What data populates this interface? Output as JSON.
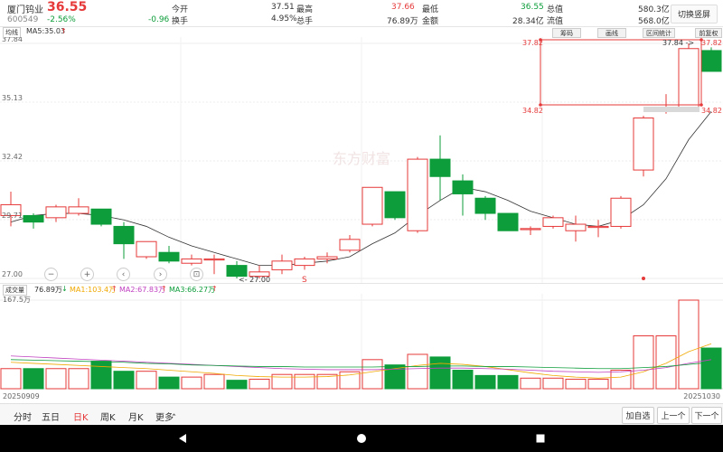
{
  "stock": {
    "name": "厦门钨业",
    "code": "600549",
    "price": "36.55",
    "change": "-0.96",
    "change_pct": "-2.56%"
  },
  "quote": {
    "open_label": "今开",
    "open": "37.51",
    "high_label": "最高",
    "high": "37.66",
    "low_label": "最低",
    "low": "36.55",
    "total_value_label": "总值",
    "total_value": "580.3亿",
    "turnover_label": "换手",
    "turnover": "4.95%",
    "volume_label": "总手",
    "volume": "76.89万",
    "amount_label": "金额",
    "amount": "28.34亿",
    "float_value_label": "流值",
    "float_value": "568.0亿"
  },
  "switch_label": "切换竖屏",
  "ma_bar": {
    "line_type": "均线",
    "ma5": "MA5:35.03",
    "ma5_arrow": "↑"
  },
  "price_axis": [
    "37.84",
    "35.13",
    "32.42",
    "29.71",
    "27.00"
  ],
  "selection_panel": {
    "top_price": "37.82",
    "bottom_price": "34.82",
    "right_top": "37.82",
    "right_bottom": "34.82",
    "chip_label": "筹码",
    "stroke_label": "画线",
    "stats_label": "区间统计",
    "adjust_label": "前复权"
  },
  "annotations": {
    "high_mark": "37.84 ->",
    "low_mark": "<- 27.00",
    "s_mark": "S"
  },
  "watermark": "东方财富",
  "tools": {
    "minus": "−",
    "plus": "+",
    "left": "‹",
    "right": "›",
    "zoom": "⊡"
  },
  "volume_bar": {
    "label": "成交量",
    "vol": "76.89万",
    "vol_arrow": "↓",
    "ma1": "MA1:103.4万",
    "ma1_arrow": "↑",
    "ma2": "MA2:67.83万",
    "ma2_arrow": "↑",
    "ma3": "MA3:66.27万",
    "ma3_arrow": "↑",
    "max": "167.5万",
    "date_start": "20250909",
    "date_end": "20251030"
  },
  "tabs": [
    "分时",
    "五日",
    "日K",
    "周K",
    "月K",
    "更多"
  ],
  "active_tab": "日K",
  "nav": {
    "add": "加自选",
    "prev": "上一个",
    "next": "下一个"
  },
  "colors": {
    "up": "#e6393a",
    "down": "#0d9d3a",
    "ma": "#333333",
    "ma1": "#f0a800",
    "ma2": "#c040c0",
    "ma3": "#0d9d3a"
  },
  "chart_data": {
    "type": "candlestick",
    "ylim": [
      27.0,
      37.84
    ],
    "candles": [
      {
        "o": 29.9,
        "c": 30.4,
        "h": 31.0,
        "l": 29.4
      },
      {
        "o": 29.9,
        "c": 29.6,
        "h": 30.0,
        "l": 29.3
      },
      {
        "o": 29.8,
        "c": 30.3,
        "h": 30.4,
        "l": 29.6
      },
      {
        "o": 30.0,
        "c": 30.3,
        "h": 30.7,
        "l": 29.9
      },
      {
        "o": 30.2,
        "c": 29.5,
        "h": 30.2,
        "l": 29.4
      },
      {
        "o": 29.4,
        "c": 28.6,
        "h": 29.6,
        "l": 27.9
      },
      {
        "o": 28.0,
        "c": 28.7,
        "h": 28.7,
        "l": 27.9
      },
      {
        "o": 28.2,
        "c": 27.8,
        "h": 28.5,
        "l": 27.7
      },
      {
        "o": 27.7,
        "c": 27.9,
        "h": 28.1,
        "l": 27.6
      },
      {
        "o": 27.9,
        "c": 27.9,
        "h": 28.1,
        "l": 27.2
      },
      {
        "o": 27.6,
        "c": 27.1,
        "h": 27.8,
        "l": 27.0
      },
      {
        "o": 27.1,
        "c": 27.3,
        "h": 27.6,
        "l": 27.0
      },
      {
        "o": 27.4,
        "c": 27.8,
        "h": 28.1,
        "l": 27.2
      },
      {
        "o": 27.6,
        "c": 27.9,
        "h": 28.0,
        "l": 27.4
      },
      {
        "o": 27.9,
        "c": 28.0,
        "h": 28.2,
        "l": 27.7
      },
      {
        "o": 28.3,
        "c": 28.8,
        "h": 29.0,
        "l": 28.2
      },
      {
        "o": 29.5,
        "c": 31.2,
        "h": 31.2,
        "l": 29.4
      },
      {
        "o": 31.0,
        "c": 29.8,
        "h": 31.0,
        "l": 29.7
      },
      {
        "o": 29.2,
        "c": 32.5,
        "h": 32.6,
        "l": 29.1
      },
      {
        "o": 32.5,
        "c": 31.7,
        "h": 33.6,
        "l": 30.6
      },
      {
        "o": 31.5,
        "c": 30.9,
        "h": 31.8,
        "l": 29.9
      },
      {
        "o": 30.7,
        "c": 30.0,
        "h": 30.8,
        "l": 29.7
      },
      {
        "o": 30.0,
        "c": 29.2,
        "h": 30.0,
        "l": 29.2
      },
      {
        "o": 29.3,
        "c": 29.3,
        "h": 29.4,
        "l": 29.0
      },
      {
        "o": 29.4,
        "c": 29.8,
        "h": 29.9,
        "l": 29.3
      },
      {
        "o": 29.2,
        "c": 29.5,
        "h": 29.9,
        "l": 28.7
      },
      {
        "o": 29.4,
        "c": 29.4,
        "h": 29.7,
        "l": 28.9
      },
      {
        "o": 29.4,
        "c": 30.7,
        "h": 30.8,
        "l": 29.3
      },
      {
        "o": 32.0,
        "c": 34.4,
        "h": 34.5,
        "l": 31.7
      },
      {
        "o": 34.8,
        "c": 34.9,
        "h": 35.5,
        "l": 34.6
      },
      {
        "o": 34.9,
        "c": 37.6,
        "h": 37.84,
        "l": 34.8
      },
      {
        "o": 37.51,
        "c": 36.55,
        "h": 37.66,
        "l": 36.55
      }
    ],
    "ma5": [
      29.6,
      29.9,
      30.0,
      30.0,
      29.9,
      29.7,
      29.4,
      28.9,
      28.5,
      28.2,
      27.9,
      27.6,
      27.6,
      27.7,
      27.8,
      28.0,
      28.6,
      29.1,
      29.9,
      30.6,
      31.2,
      31.0,
      30.6,
      30.1,
      29.8,
      29.5,
      29.4,
      29.7,
      30.4,
      31.6,
      33.4,
      34.7
    ],
    "volume": {
      "unit": "万",
      "ylim": [
        0,
        167.5
      ],
      "values": [
        38,
        38,
        38,
        38,
        52,
        33,
        33,
        22,
        22,
        27,
        16,
        18,
        27,
        27,
        27,
        32,
        55,
        45,
        65,
        60,
        35,
        25,
        25,
        20,
        20,
        18,
        18,
        35,
        100,
        100,
        167.5,
        76.89
      ],
      "ma1": [
        50,
        48,
        46,
        44,
        42,
        40,
        38,
        35,
        32,
        29,
        25,
        23,
        22,
        22,
        23,
        26,
        32,
        38,
        44,
        48,
        46,
        42,
        36,
        30,
        25,
        22,
        20,
        22,
        32,
        48,
        70,
        85
      ],
      "ma2": [
        62,
        60,
        58,
        56,
        54,
        52,
        50,
        48,
        46,
        44,
        42,
        40,
        38,
        37,
        36,
        36,
        36,
        37,
        38,
        39,
        39,
        38,
        37,
        35,
        33,
        32,
        31,
        32,
        35,
        40,
        48,
        55
      ],
      "ma3": [
        55,
        54,
        53,
        52,
        51,
        50,
        48,
        47,
        45,
        44,
        43,
        42,
        42,
        41,
        41,
        41,
        41,
        42,
        42,
        43,
        43,
        42,
        42,
        41,
        40,
        39,
        38,
        38,
        40,
        42,
        46,
        50
      ]
    }
  }
}
